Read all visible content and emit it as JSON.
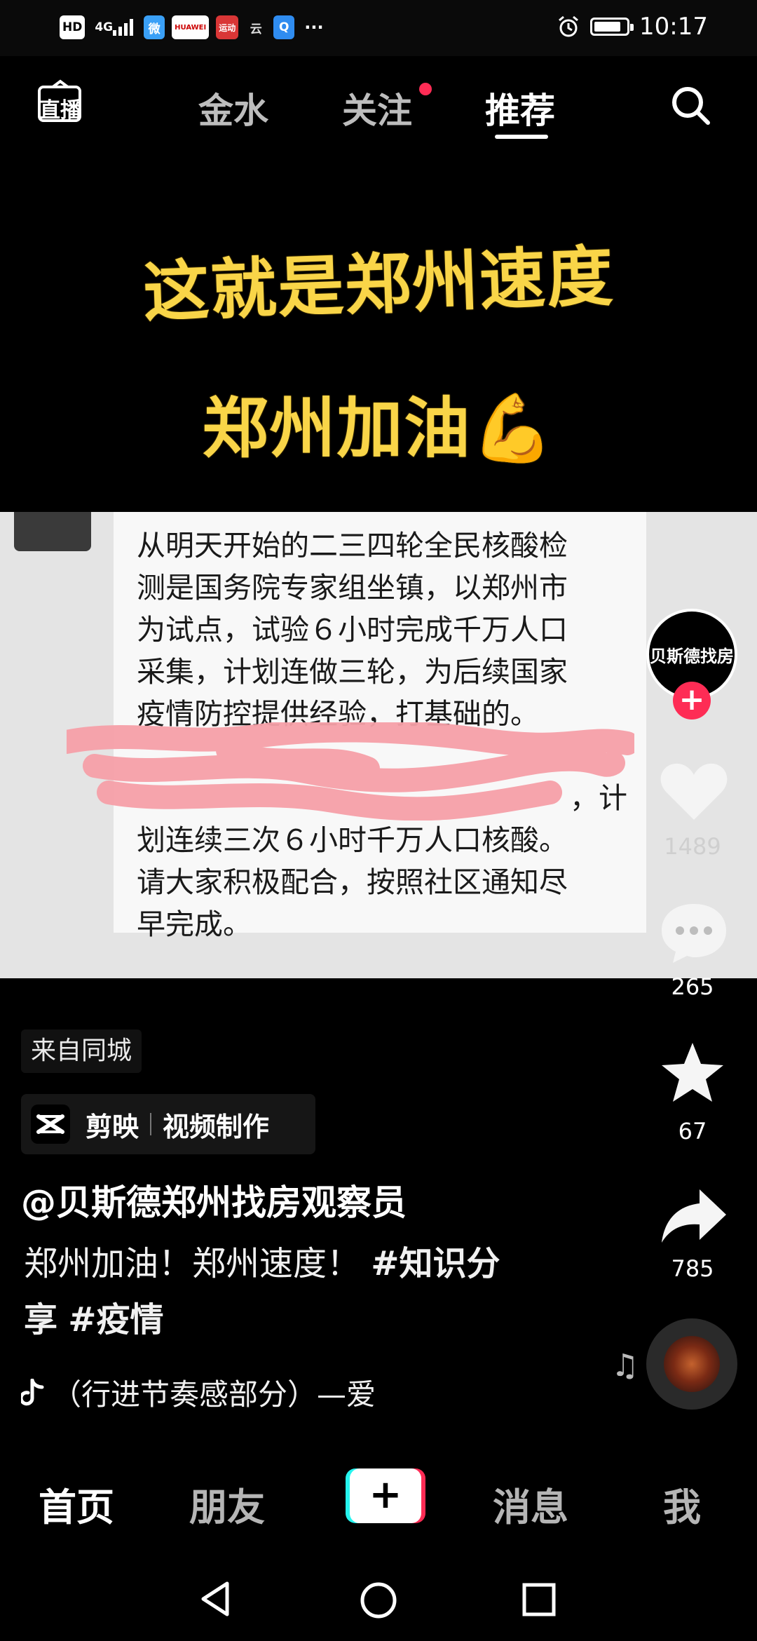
{
  "status_bar": {
    "left_chips": [
      "HD",
      "4G",
      "微",
      "HUAWEI",
      "运动",
      "云",
      "Q",
      "···"
    ],
    "time": "10:17",
    "battery_level": 0.85
  },
  "top_nav": {
    "live_label": "直播",
    "tabs": [
      {
        "label": "金水",
        "active": false
      },
      {
        "label": "关注",
        "active": false,
        "has_dot": true
      },
      {
        "label": "推荐",
        "active": true
      }
    ]
  },
  "video": {
    "headline_1": "这就是郑州速度",
    "headline_2": "郑州加油💪",
    "document_lines": [
      "从明天开始的二三四轮全民核酸检",
      "测是国务院专家组坐镇，以郑州市",
      "为试点，试验６小时完成千万人口",
      "采集，计划连做三轮，为后续国家",
      "疫情防控提供经验，打基础的。",
      "　　　　　　　　　　　　　　",
      "　　　　　　　　　　　　　，计",
      "划连续三次６小时千万人口核酸。",
      "请大家积极配合，按照社区通知尽",
      "早完成。"
    ]
  },
  "right_rail": {
    "profile_name": "贝斯德找房",
    "likes": "1489",
    "comments": "265",
    "favorites": "67",
    "shares": "785"
  },
  "caption": {
    "from_city": "来自同城",
    "capcut_app": "剪映",
    "capcut_tag": "视频制作",
    "author": "@贝斯德郑州找房观察员",
    "desc_text": "郑州加油！郑州速度！",
    "hashtag_1": "#知识分",
    "hashtag_1_cont": "享",
    "hashtag_2": "#疫情",
    "music": "（行进节奏感部分）—爱"
  },
  "bottom_nav": {
    "home": "首页",
    "friends": "朋友",
    "create": "+",
    "messages": "消息",
    "me": "我"
  },
  "colors": {
    "accent_red": "#fe2c55",
    "accent_cyan": "#25f4ee",
    "headline_yellow": "#f9d548"
  }
}
